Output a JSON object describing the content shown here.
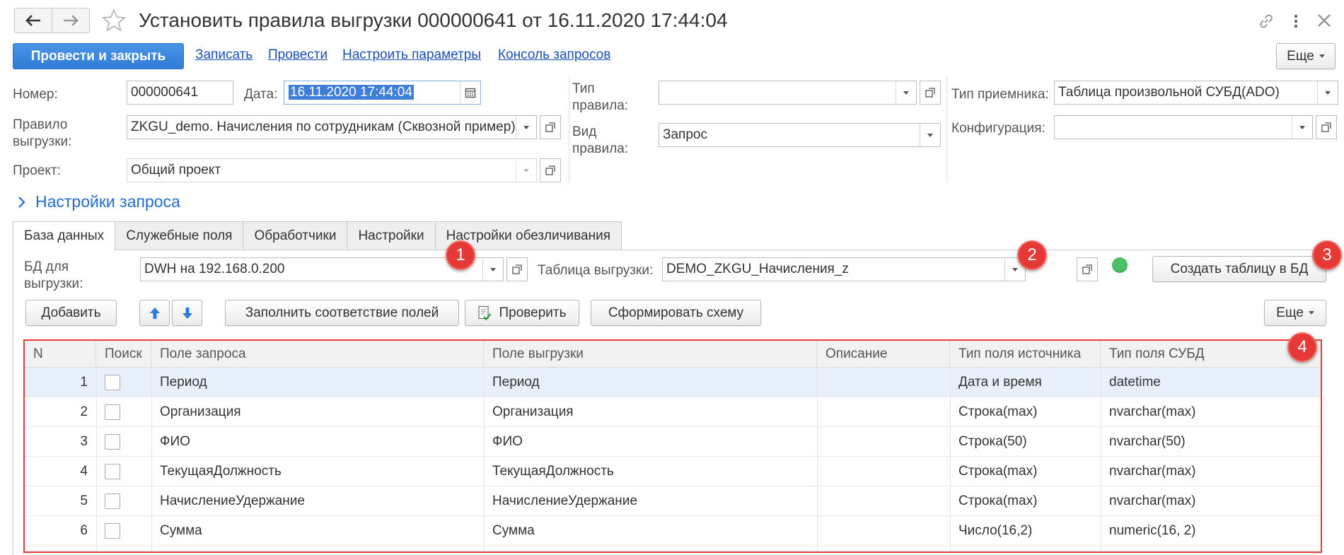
{
  "window": {
    "title": "Установить правила выгрузки 000000641 от 16.11.2020 17:44:04"
  },
  "toolbar": {
    "post_and_close": "Провести и закрыть",
    "write": "Записать",
    "post": "Провести",
    "setup_params": "Настроить параметры",
    "query_console": "Консоль запросов",
    "more": "Еще"
  },
  "form": {
    "number_label": "Номер:",
    "number_value": "000000641",
    "date_label": "Дата:",
    "date_value": "16.11.2020 17:44:04",
    "rule_label": "Правило выгрузки:",
    "rule_label_line1": "Правило",
    "rule_label_line2": "выгрузки:",
    "rule_value": "ZKGU_demo. Начисления по сотрудникам (Сквозной пример)",
    "project_label": "Проект:",
    "project_value": "Общий проект",
    "rule_type_label_line1": "Тип",
    "rule_type_label_line2": "правила:",
    "rule_type_value": "",
    "rule_kind_label_line1": "Вид",
    "rule_kind_label_line2": "правила:",
    "rule_kind_value": "Запрос",
    "receiver_type_label": "Тип приемника:",
    "receiver_type_value": "Таблица произвольной СУБД(ADO)",
    "configuration_label": "Конфигурация:",
    "configuration_value": ""
  },
  "section": {
    "query_settings": "Настройки запроса"
  },
  "tabs": [
    {
      "label": "База данных",
      "active": true
    },
    {
      "label": "Служебные поля",
      "active": false
    },
    {
      "label": "Обработчики",
      "active": false
    },
    {
      "label": "Настройки",
      "active": false
    },
    {
      "label": "Настройки обезличивания",
      "active": false
    }
  ],
  "db_panel": {
    "db_label_line1": "БД для",
    "db_label_line2": "выгрузки:",
    "db_value": "DWH на 192.168.0.200",
    "table_label": "Таблица выгрузки:",
    "table_value": "DEMO_ZKGU_Начисления_z",
    "status_color": "#4cc265",
    "create_table": "Создать таблицу в БД"
  },
  "table_toolbar": {
    "add": "Добавить",
    "fill_mapping": "Заполнить соответствие полей",
    "check": "Проверить",
    "build_schema": "Сформировать схему",
    "more": "Еще"
  },
  "badges": [
    "1",
    "2",
    "3",
    "4"
  ],
  "table": {
    "columns": [
      "N",
      "Поиск",
      "Поле запроса",
      "Поле выгрузки",
      "Описание",
      "Тип поля источника",
      "Тип поля СУБД"
    ],
    "rows": [
      {
        "n": "1",
        "search": false,
        "query_field": "Период",
        "export_field": "Период",
        "description": "",
        "source_type": "Дата и время",
        "db_type": "datetime"
      },
      {
        "n": "2",
        "search": false,
        "query_field": "Организация",
        "export_field": "Организация",
        "description": "",
        "source_type": "Строка(max)",
        "db_type": "nvarchar(max)"
      },
      {
        "n": "3",
        "search": false,
        "query_field": "ФИО",
        "export_field": "ФИО",
        "description": "",
        "source_type": "Строка(50)",
        "db_type": "nvarchar(50)"
      },
      {
        "n": "4",
        "search": false,
        "query_field": "ТекущаяДолжность",
        "export_field": "ТекущаяДолжность",
        "description": "",
        "source_type": "Строка(max)",
        "db_type": "nvarchar(max)"
      },
      {
        "n": "5",
        "search": false,
        "query_field": "НачислениеУдержание",
        "export_field": "НачислениеУдержание",
        "description": "",
        "source_type": "Строка(max)",
        "db_type": "nvarchar(max)"
      },
      {
        "n": "6",
        "search": false,
        "query_field": "Сумма",
        "export_field": "Сумма",
        "description": "",
        "source_type": "Число(16,2)",
        "db_type": "numeric(16, 2)"
      }
    ]
  },
  "colors": {
    "accent": "#3c8ae0",
    "link": "#1a4fb8",
    "section": "#1f6bd0",
    "highlight_border": "#e53935",
    "selected_row": "#e8f1fb"
  }
}
